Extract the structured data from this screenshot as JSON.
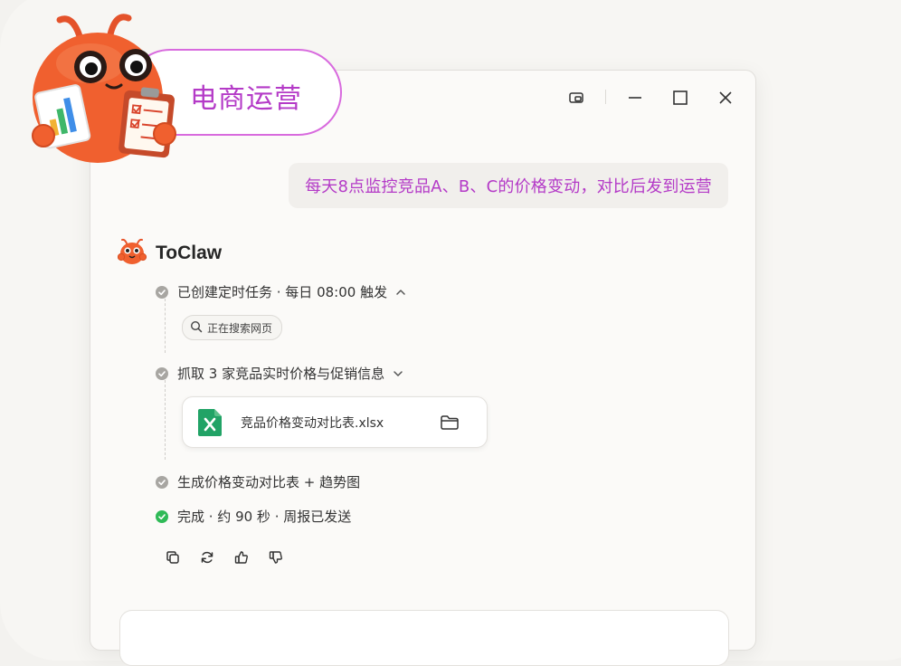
{
  "scenario_tag": "电商运营",
  "user_message": "每天8点监控竞品A、B、C的价格变动，对比后发到运营",
  "assistant": {
    "name": "ToClaw"
  },
  "steps": [
    {
      "text": "已创建定时任务 · 每日 08:00 触发",
      "status": "done",
      "expanded": true
    },
    {
      "text": "抓取 3 家竞品实时价格与促销信息",
      "status": "done",
      "expanded": false
    },
    {
      "text": "生成价格变动对比表 + 趋势图",
      "status": "done"
    },
    {
      "text": "完成 · 约 90 秒 · 周报已发送",
      "status": "success"
    }
  ],
  "search_chip": {
    "label": "正在搜索网页",
    "icon": "search-icon"
  },
  "file_card": {
    "name": "竞品价格变动对比表.xlsx",
    "icon": "excel-icon",
    "action_icon": "folder-icon"
  },
  "message_actions": [
    "copy-icon",
    "regenerate-icon",
    "thumbs-up-icon",
    "thumbs-down-icon"
  ],
  "window_controls": [
    "picture-in-picture-icon",
    "minimize-icon",
    "maximize-icon",
    "close-icon"
  ],
  "colors": {
    "accent": "#b43ac7",
    "success": "#2fba57",
    "mascot": "#f0602f",
    "excel": "#21a366"
  }
}
